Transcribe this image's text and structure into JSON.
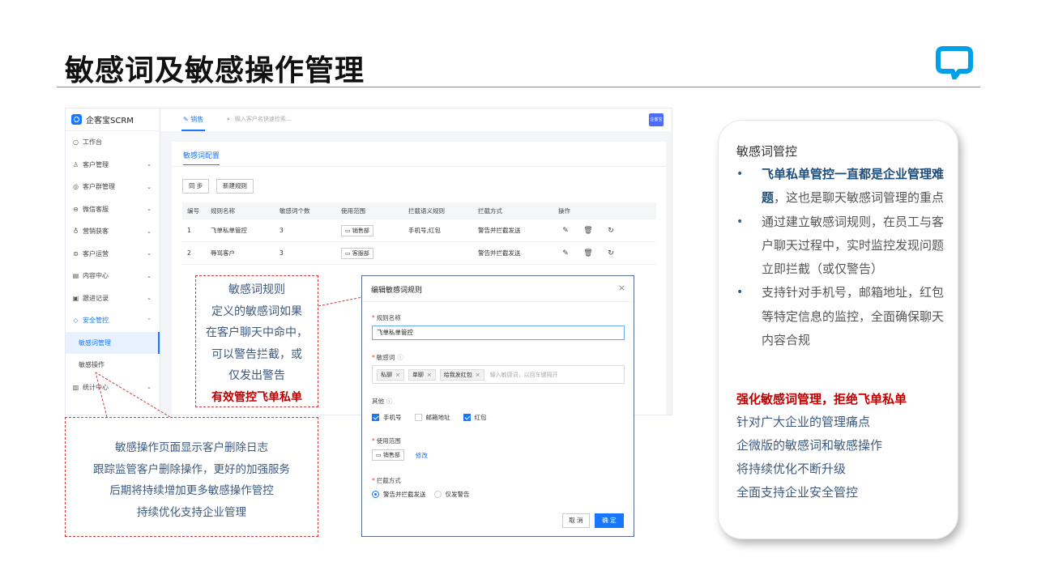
{
  "slide": {
    "title": "敏感词及敏感操作管理",
    "logo_icon": "chat-bubble-logo-icon",
    "accent": "#00a0e9"
  },
  "app": {
    "brand": "企客宝SCRM",
    "sidebar": {
      "items": [
        {
          "label": "工作台",
          "icon": "○"
        },
        {
          "label": "客户管理",
          "icon": "♙"
        },
        {
          "label": "客户群管理",
          "icon": "◎"
        },
        {
          "label": "微信客服",
          "icon": "⊖"
        },
        {
          "label": "营销获客",
          "icon": "♁"
        },
        {
          "label": "客户运营",
          "icon": "⊜"
        },
        {
          "label": "内容中心",
          "icon": "▤"
        },
        {
          "label": "跟进记录",
          "icon": "▣"
        },
        {
          "label": "安全管控",
          "icon": "◇"
        }
      ],
      "sub_items": [
        "敏感词管理",
        "敏感操作"
      ],
      "last_item": {
        "label": "统计中心",
        "icon": "▥"
      }
    },
    "topbar": {
      "tab": "销售",
      "search_placeholder": "输入客户名快速检索...",
      "user": "企客宝"
    },
    "content": {
      "tab": "敏感词配置",
      "buttons": {
        "sync": "同 步",
        "new_rule": "新建规则"
      },
      "table": {
        "headers": [
          "编号",
          "规则名称",
          "敏感词个数",
          "使用范围",
          "拦截语义规则",
          "拦截方式",
          "操作"
        ],
        "rows": [
          {
            "id": "1",
            "name": "飞单私单管控",
            "count": "3",
            "scope": "销售部",
            "semantic": "手机号,红包",
            "method": "警告并拦截发送"
          },
          {
            "id": "2",
            "name": "辱骂客户",
            "count": "3",
            "scope": "客服部",
            "semantic": "",
            "method": "警告并拦截发送"
          }
        ]
      }
    }
  },
  "dialog": {
    "title": "编辑敏感词规则",
    "close": "×",
    "name_label": "规则名称",
    "name_value": "飞单私单管控",
    "words_label": "敏感词",
    "words": [
      "私聊",
      "单聊",
      "给我发红包"
    ],
    "words_placeholder": "输入敏感词，以回车键隔开",
    "other_label": "其他",
    "other_options": [
      {
        "label": "手机号",
        "checked": true
      },
      {
        "label": "邮箱地址",
        "checked": false
      },
      {
        "label": "红包",
        "checked": true
      }
    ],
    "scope_label": "使用范围",
    "scope_value": "销售部",
    "scope_edit": "修改",
    "method_label": "拦截方式",
    "method_options": [
      {
        "label": "警告并拦截发送",
        "selected": true
      },
      {
        "label": "仅发警告",
        "selected": false
      }
    ],
    "cancel": "取 消",
    "ok": "确 定"
  },
  "callouts": {
    "rule": {
      "lines": [
        "敏感词规则",
        "定义的敏感词如果",
        "在客户聊天中命中，",
        "可以警告拦截，或",
        "仅发出警告"
      ],
      "emphasis": "有效管控飞单私单"
    },
    "ops": {
      "lines": [
        "敏感操作页面显示客户删除日志",
        "跟踪监管客户删除操作，更好的加强服务",
        "后期将持续增加更多敏感操作管控",
        "持续优化支持企业管理"
      ]
    }
  },
  "card": {
    "heading": "敏感词管控",
    "bullet1_bold": "飞单私单管控一直都是企业管理难题",
    "bullet1_rest": "，这也是聊天敏感词管理的重点",
    "bullet2": "通过建立敏感词规则，在员工与客户聊天过程中，实时监控发现问题立即拦截（或仅警告）",
    "bullet3": "支持针对手机号，邮箱地址，红包等特定信息的监控，全面确保聊天内容合规",
    "strong": "强化敏感词管理，拒绝飞单私单",
    "lines": [
      "针对广大企业的管理痛点",
      "企微版的敏感词和敏感操作",
      "将持续优化不断升级",
      "全面支持企业安全管控"
    ]
  }
}
